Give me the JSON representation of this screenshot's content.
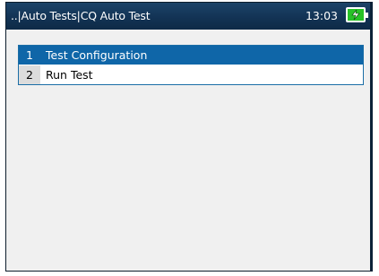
{
  "titlebar": {
    "title": "..|Auto Tests|CQ Auto Test",
    "time": "13:03",
    "battery_icon": "battery-charging-icon",
    "battery_color": "#27c227"
  },
  "menu": {
    "items": [
      {
        "number": "1",
        "label": "Test Configuration",
        "selected": true
      },
      {
        "number": "2",
        "label": "Run Test",
        "selected": false
      }
    ]
  },
  "colors": {
    "titlebar": "#123253",
    "selection": "#0f66a8",
    "background": "#f0f0f0"
  }
}
